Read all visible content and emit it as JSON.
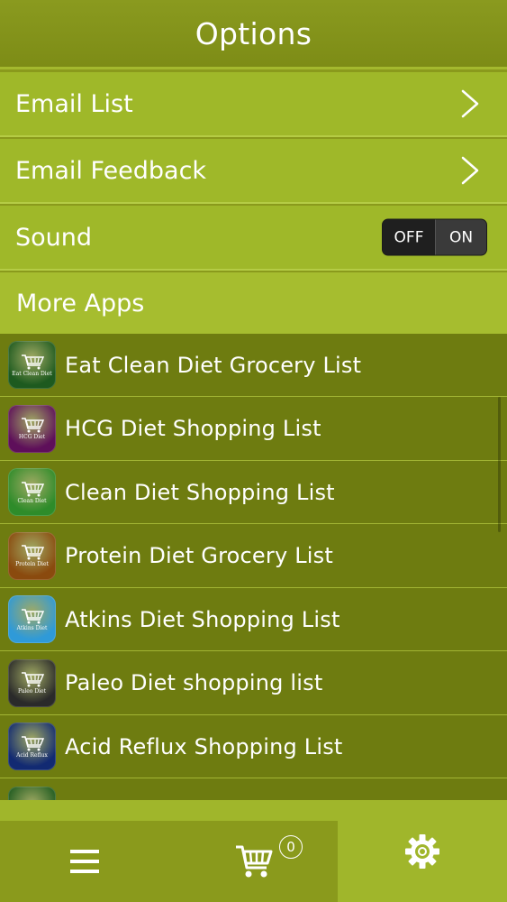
{
  "header": {
    "title": "Options"
  },
  "options": [
    {
      "label": "Email List",
      "type": "link"
    },
    {
      "label": "Email Feedback",
      "type": "link"
    },
    {
      "label": "Sound",
      "type": "toggle",
      "toggle": {
        "off_label": "OFF",
        "on_label": "ON",
        "state": "on"
      }
    }
  ],
  "more_apps": {
    "title": "More Apps",
    "apps": [
      {
        "name": "Eat Clean Diet Grocery List",
        "icon_caption": "Eat Clean Diet",
        "icon_color": "#1d5a1f"
      },
      {
        "name": "HCG Diet Shopping List",
        "icon_caption": "HCG Diet",
        "icon_color": "#5e0f5a"
      },
      {
        "name": "Clean Diet Shopping List",
        "icon_caption": "Clean Diet",
        "icon_color": "#2e8c2a"
      },
      {
        "name": "Protein Diet Grocery List",
        "icon_caption": "Protein Diet",
        "icon_color": "#8a4a0e"
      },
      {
        "name": "Atkins Diet Shopping List",
        "icon_caption": "Atkins Diet",
        "icon_color": "#2f9ad8"
      },
      {
        "name": "Paleo Diet shopping list",
        "icon_caption": "Paleo Diet",
        "icon_color": "#2a2a2a"
      },
      {
        "name": "Acid Reflux Shopping List",
        "icon_caption": "Acid Reflux",
        "icon_color": "#122a72"
      },
      {
        "name": "",
        "icon_caption": "",
        "icon_color": "#1d5a1f"
      }
    ]
  },
  "tabbar": {
    "tabs": [
      {
        "id": "list",
        "icon": "hamburger-icon"
      },
      {
        "id": "cart",
        "icon": "cart-icon",
        "badge": "0"
      },
      {
        "id": "settings",
        "icon": "gear-icon",
        "selected": true
      }
    ]
  },
  "colors": {
    "accent": "#a0b62b",
    "dark": "#6e7c10",
    "nav": "#8a9a1c"
  }
}
